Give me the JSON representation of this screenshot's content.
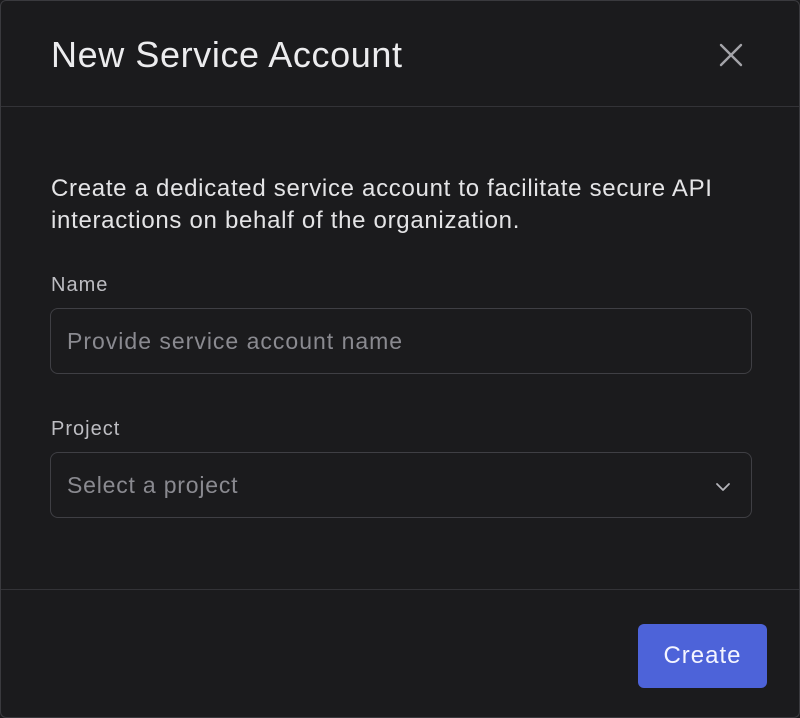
{
  "dialog": {
    "title": "New Service Account",
    "close_icon": "close-icon",
    "description": "Create a dedicated service account to facilitate secure API interactions on behalf of the organization."
  },
  "form": {
    "name": {
      "label": "Name",
      "value": "",
      "placeholder": "Provide service account name"
    },
    "project": {
      "label": "Project",
      "selected": "Select a project",
      "icon": "chevron-down-icon"
    }
  },
  "footer": {
    "create_label": "Create"
  },
  "colors": {
    "background": "#1b1b1d",
    "border": "#3f3f44",
    "accent": "#4d63d9",
    "text": "#e8e8ea",
    "muted": "#8a8a90"
  }
}
